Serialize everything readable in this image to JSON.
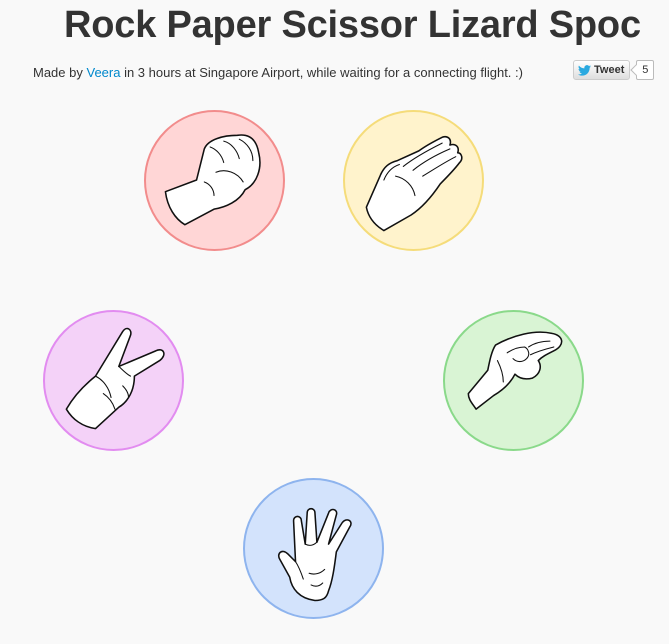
{
  "header": {
    "title": "Rock Paper Scissor Lizard Spoc"
  },
  "credits": {
    "prefix": "Made by ",
    "author": "Veera",
    "suffix": " in 3 hours at Singapore Airport, while waiting for a connecting flight. :)"
  },
  "tweet": {
    "label": "Tweet",
    "count": "5",
    "icon": "twitter-bird-icon"
  },
  "choices": [
    {
      "id": "rock",
      "icon": "rock-fist-icon",
      "fill": "#ffd6d6",
      "border": "#f28c8c"
    },
    {
      "id": "paper",
      "icon": "paper-hand-icon",
      "fill": "#fff3cc",
      "border": "#f5dc7a"
    },
    {
      "id": "scissors",
      "icon": "scissors-hand-icon",
      "fill": "#f4d2f8",
      "border": "#e28cf0"
    },
    {
      "id": "lizard",
      "icon": "lizard-hand-icon",
      "fill": "#d9f4d4",
      "border": "#8ad98a"
    },
    {
      "id": "spock",
      "icon": "spock-hand-icon",
      "fill": "#d3e3fc",
      "border": "#8eb4ee"
    }
  ]
}
